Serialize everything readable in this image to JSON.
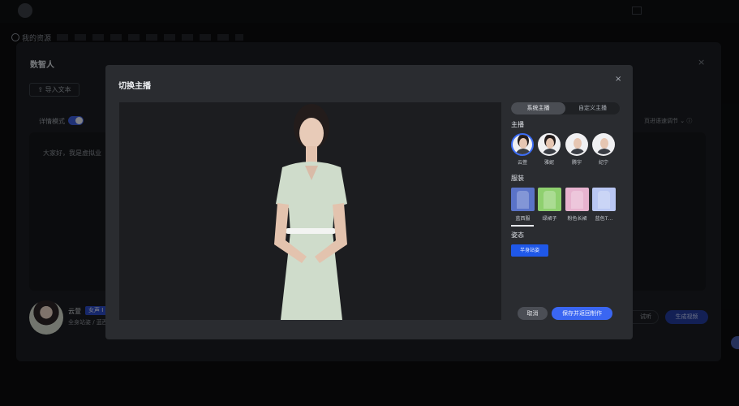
{
  "outer": {
    "title": "数智人",
    "close": "×",
    "import_label": "导入文本",
    "detail_mode_label": "详情模式",
    "detail_mode_on": true,
    "body_text": "大家好，我是虚拟业",
    "body_tail": "!",
    "speed_hint": "页进语速调节 ⌄",
    "char_count": "",
    "anchor_name": "云萱",
    "gender_badge": "女声 I",
    "anchor_sub": "全身站姿 / 蓝西",
    "try_label": "试听",
    "generate_label": "生成视频"
  },
  "subbar": {
    "back_label": "我的资源"
  },
  "modal": {
    "title": "切换主播",
    "close": "×",
    "tabs": [
      {
        "label": "系统主播",
        "active": true
      },
      {
        "label": "自定义主播",
        "active": false
      }
    ],
    "anchor_section": "主播",
    "anchors": [
      {
        "name": "云萱",
        "selected": true,
        "female": true
      },
      {
        "name": "雅妮",
        "selected": false,
        "female": true
      },
      {
        "name": "腾宇",
        "selected": false,
        "female": false
      },
      {
        "name": "纪宁",
        "selected": false,
        "female": false
      }
    ],
    "outfit_section": "服装",
    "outfits": [
      {
        "name": "蓝西服",
        "color": "#5a73c8"
      },
      {
        "name": "绿裙子",
        "color": "#8fd06f"
      },
      {
        "name": "粉色长裙",
        "color": "#e7b3cf"
      },
      {
        "name": "蓝色T…",
        "color": "#b9c7f3"
      }
    ],
    "pose_section": "姿态",
    "pose_label": "半身站姿",
    "cancel_label": "取消",
    "save_label": "保存并返回制作"
  }
}
